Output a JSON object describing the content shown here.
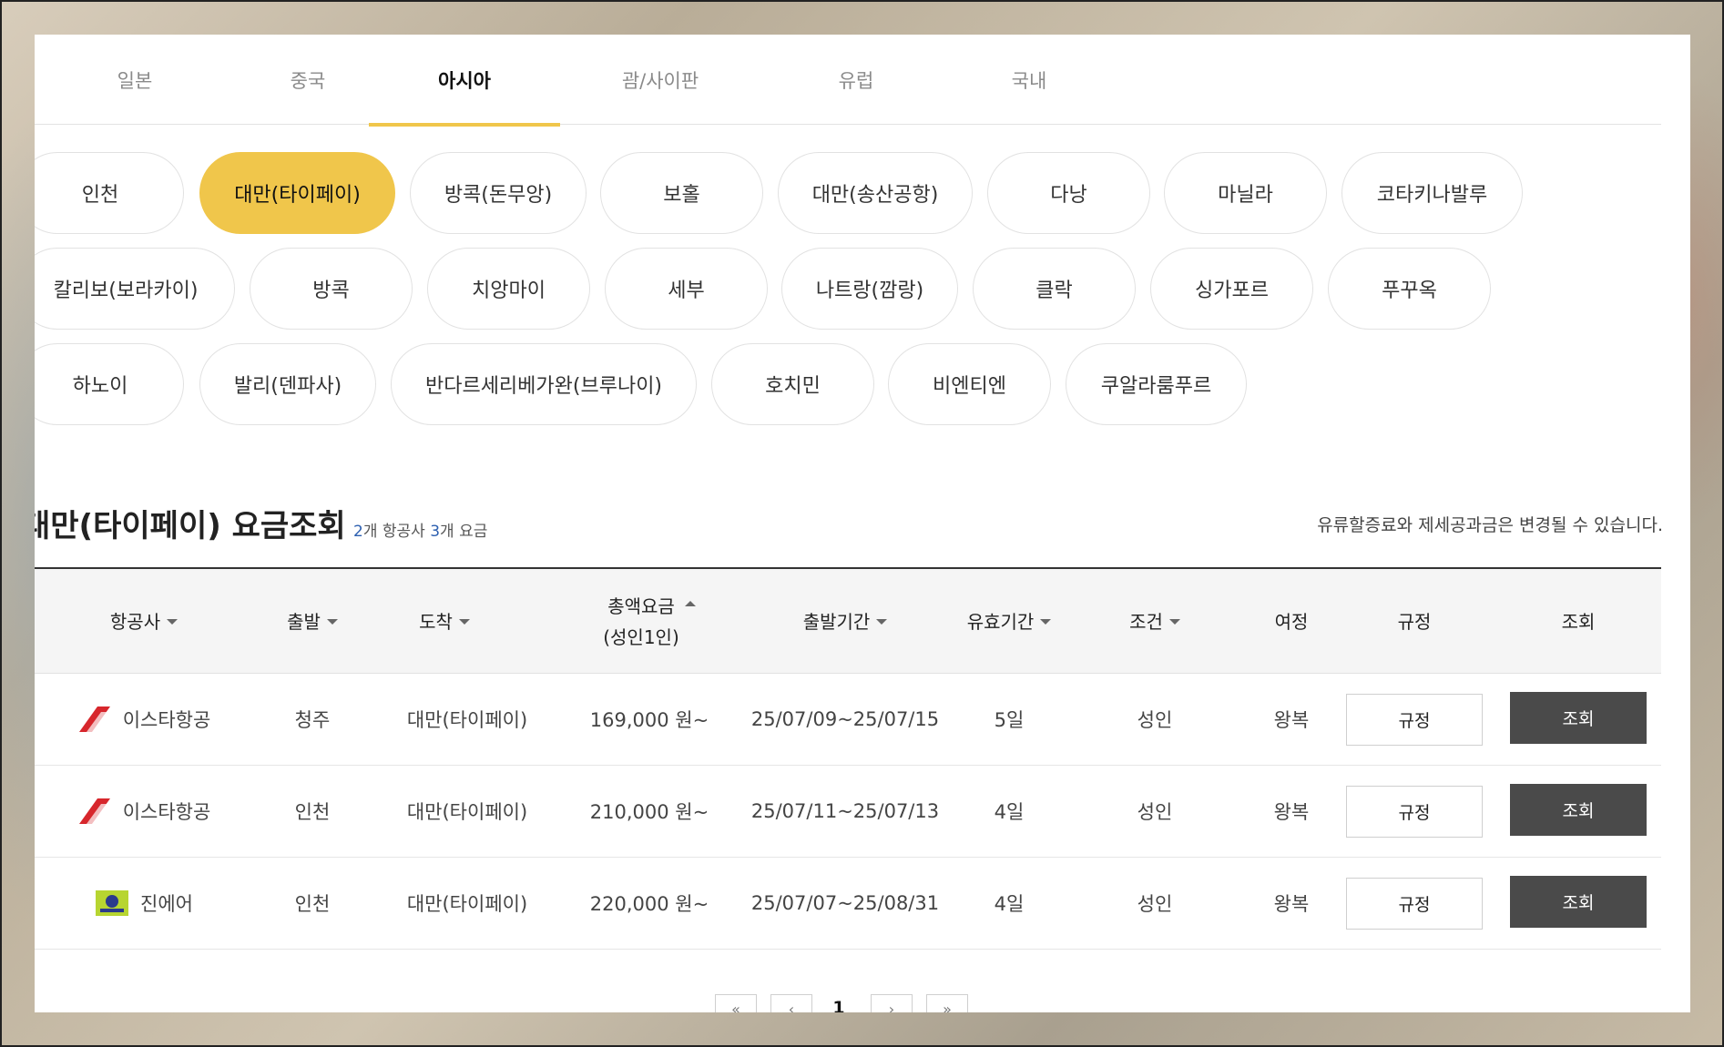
{
  "region_tabs": [
    {
      "label": "일본"
    },
    {
      "label": "중국"
    },
    {
      "label": "아시아",
      "active": true
    },
    {
      "label": "괌/사이판"
    },
    {
      "label": "유럽"
    },
    {
      "label": "국내"
    }
  ],
  "cities": [
    {
      "label": "인천"
    },
    {
      "label": "대만(타이페이)",
      "active": true
    },
    {
      "label": "방콕(돈무앙)"
    },
    {
      "label": "보홀"
    },
    {
      "label": "대만(송산공항)"
    },
    {
      "label": "다낭"
    },
    {
      "label": "마닐라"
    },
    {
      "label": "코타키나발루"
    },
    {
      "label": "칼리보(보라카이)"
    },
    {
      "label": "방콕"
    },
    {
      "label": "치앙마이"
    },
    {
      "label": "세부"
    },
    {
      "label": "나트랑(깜랑)"
    },
    {
      "label": "클락"
    },
    {
      "label": "싱가포르"
    },
    {
      "label": "푸꾸옥"
    },
    {
      "label": "하노이"
    },
    {
      "label": "발리(덴파사)"
    },
    {
      "label": "반다르세리베가완(브루나이)"
    },
    {
      "label": "호치민"
    },
    {
      "label": "비엔티엔"
    },
    {
      "label": "쿠알라룸푸르"
    }
  ],
  "fare": {
    "title": "대만(타이페이) 요금조회",
    "airline_count": "2",
    "airline_count_suffix": "개 항공사 ",
    "fare_count": "3",
    "fare_count_suffix": "개 요금",
    "notice": "유류할증료와 제세공과금은 변경될 수 있습니다."
  },
  "table": {
    "headers": {
      "airline": "항공사",
      "departure": "출발",
      "arrival": "도착",
      "total_fare_line1": "총액요금",
      "total_fare_line2": "(성인1인)",
      "departure_period": "출발기간",
      "validity": "유효기간",
      "condition": "조건",
      "itinerary": "여정",
      "rule": "규정",
      "view": "조회"
    },
    "rows": [
      {
        "airline": "이스타항공",
        "logo": "eastar-jet-logo",
        "departure": "청주",
        "arrival": "대만(타이페이)",
        "fare": "169,000 원~",
        "period": "25/07/09~25/07/15",
        "validity": "5일",
        "condition": "성인",
        "itinerary": "왕복",
        "rule_label": "규정",
        "view_label": "조회"
      },
      {
        "airline": "이스타항공",
        "logo": "eastar-jet-logo",
        "departure": "인천",
        "arrival": "대만(타이페이)",
        "fare": "210,000 원~",
        "period": "25/07/11~25/07/13",
        "validity": "4일",
        "condition": "성인",
        "itinerary": "왕복",
        "rule_label": "규정",
        "view_label": "조회"
      },
      {
        "airline": "진에어",
        "logo": "jin-air-logo",
        "departure": "인천",
        "arrival": "대만(타이페이)",
        "fare": "220,000 원~",
        "period": "25/07/07~25/08/31",
        "validity": "4일",
        "condition": "성인",
        "itinerary": "왕복",
        "rule_label": "규정",
        "view_label": "조회"
      }
    ]
  },
  "pagination": {
    "first": "«",
    "prev": "‹",
    "current": "1",
    "next": "›",
    "last": "»"
  },
  "colors": {
    "accent": "#f0c64b",
    "view_button": "#4a4a4a",
    "count_number": "#2c5fb0"
  }
}
